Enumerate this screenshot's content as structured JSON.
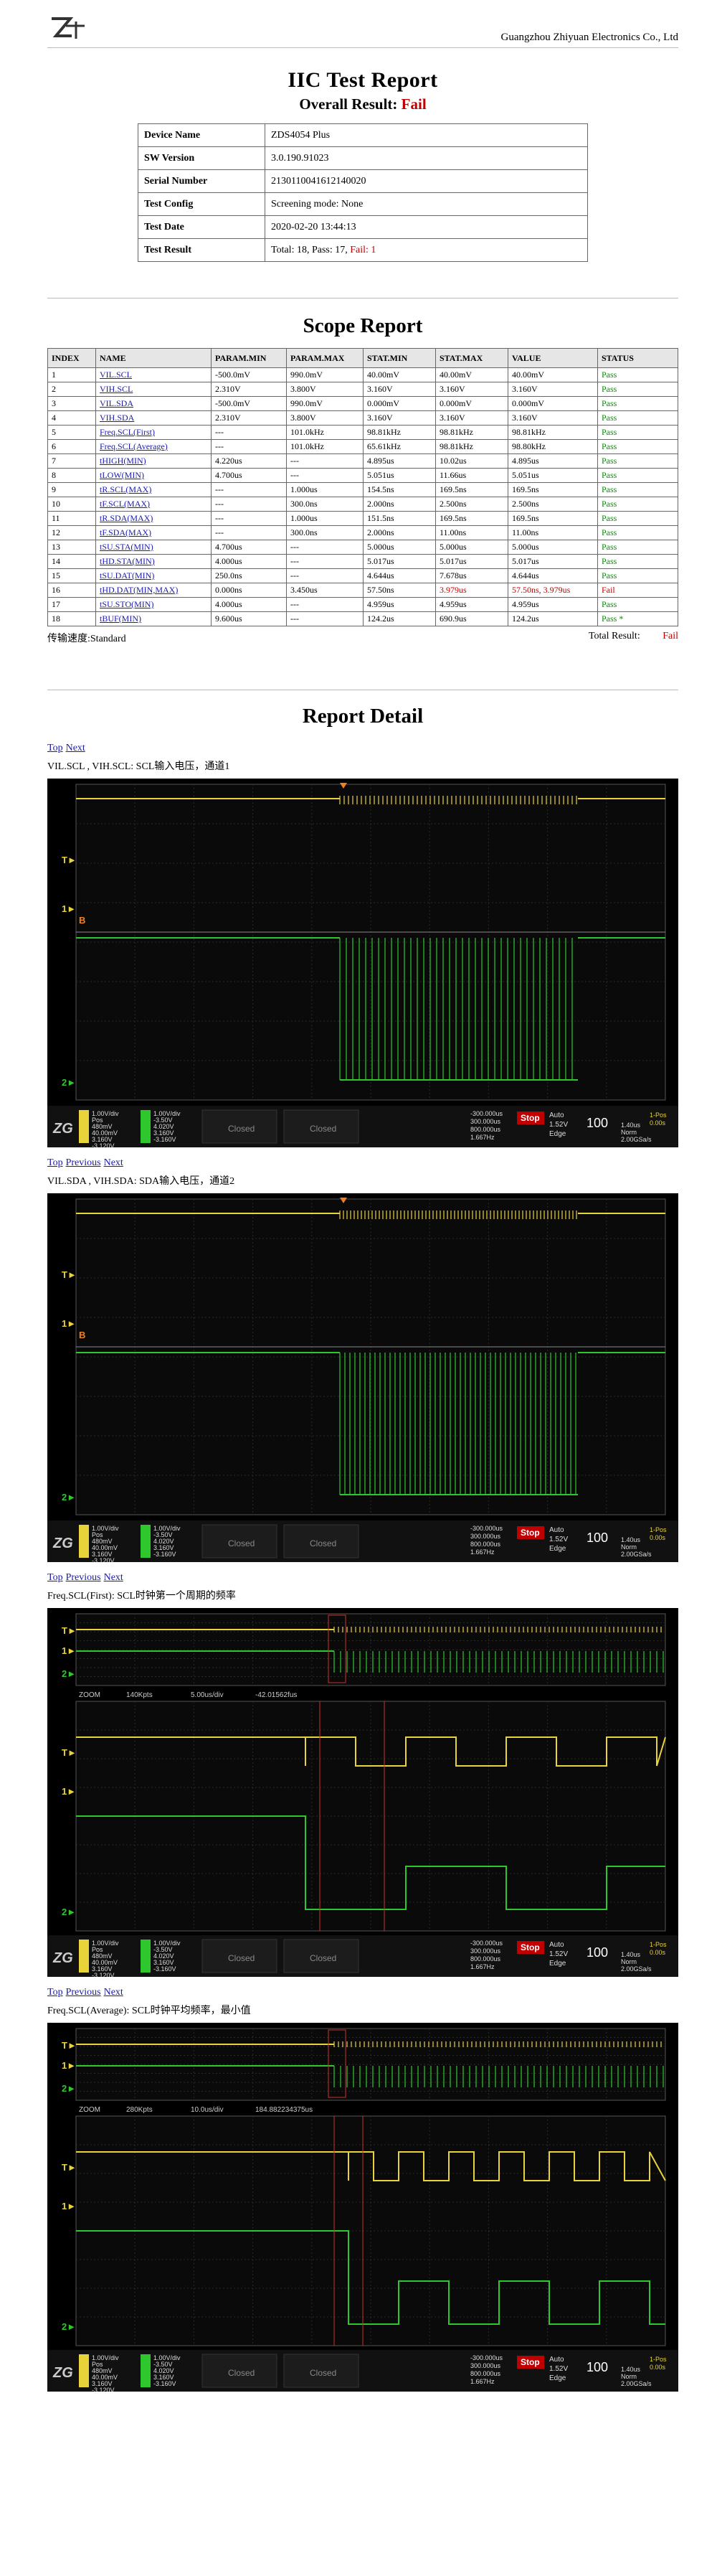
{
  "header": {
    "company": "Guangzhou Zhiyuan Electronics Co., Ltd"
  },
  "report": {
    "title": "IIC Test Report",
    "overall_label": "Overall Result: ",
    "overall_value": "Fail"
  },
  "info": {
    "device_name_k": "Device Name",
    "device_name_v": "ZDS4054 Plus",
    "sw_version_k": "SW Version",
    "sw_version_v": "3.0.190.91023",
    "serial_k": "Serial Number",
    "serial_v": "2130110041612140020",
    "config_k": "Test Config",
    "config_v": "Screening mode: None",
    "date_k": "Test Date",
    "date_v": "2020-02-20 13:44:13",
    "result_k": "Test Result",
    "result_prefix": "Total: 18, Pass: 17, ",
    "result_fail": "Fail: 1"
  },
  "scope": {
    "title": "Scope Report",
    "headers": [
      "INDEX",
      "NAME",
      "PARAM.MIN",
      "PARAM.MAX",
      "STAT.MIN",
      "STAT.MAX",
      "VALUE",
      "STATUS"
    ],
    "rows": [
      [
        "1",
        "VIL.SCL",
        "-500.0mV",
        "990.0mV",
        "40.00mV",
        "40.00mV",
        "40.00mV",
        "Pass"
      ],
      [
        "2",
        "VIH.SCL",
        "2.310V",
        "3.800V",
        "3.160V",
        "3.160V",
        "3.160V",
        "Pass"
      ],
      [
        "3",
        "VIL.SDA",
        "-500.0mV",
        "990.0mV",
        "0.000mV",
        "0.000mV",
        "0.000mV",
        "Pass"
      ],
      [
        "4",
        "VIH.SDA",
        "2.310V",
        "3.800V",
        "3.160V",
        "3.160V",
        "3.160V",
        "Pass"
      ],
      [
        "5",
        "Freq.SCL(First)",
        "---",
        "101.0kHz",
        "98.81kHz",
        "98.81kHz",
        "98.81kHz",
        "Pass"
      ],
      [
        "6",
        "Freq.SCL(Average)",
        "---",
        "101.0kHz",
        "65.61kHz",
        "98.81kHz",
        "98.80kHz",
        "Pass"
      ],
      [
        "7",
        "tHIGH(MIN)",
        "4.220us",
        "---",
        "4.895us",
        "10.02us",
        "4.895us",
        "Pass"
      ],
      [
        "8",
        "tLOW(MIN)",
        "4.700us",
        "---",
        "5.051us",
        "11.66us",
        "5.051us",
        "Pass"
      ],
      [
        "9",
        "tR.SCL(MAX)",
        "---",
        "1.000us",
        "154.5ns",
        "169.5ns",
        "169.5ns",
        "Pass"
      ],
      [
        "10",
        "tF.SCL(MAX)",
        "---",
        "300.0ns",
        "2.000ns",
        "2.500ns",
        "2.500ns",
        "Pass"
      ],
      [
        "11",
        "tR.SDA(MAX)",
        "---",
        "1.000us",
        "151.5ns",
        "169.5ns",
        "169.5ns",
        "Pass"
      ],
      [
        "12",
        "tF.SDA(MAX)",
        "---",
        "300.0ns",
        "2.000ns",
        "11.00ns",
        "11.00ns",
        "Pass"
      ],
      [
        "13",
        "tSU.STA(MIN)",
        "4.700us",
        "---",
        "5.000us",
        "5.000us",
        "5.000us",
        "Pass"
      ],
      [
        "14",
        "tHD.STA(MIN)",
        "4.000us",
        "---",
        "5.017us",
        "5.017us",
        "5.017us",
        "Pass"
      ],
      [
        "15",
        "tSU.DAT(MIN)",
        "250.0ns",
        "---",
        "4.644us",
        "7.678us",
        "4.644us",
        "Pass"
      ],
      [
        "16",
        "tHD.DAT(MIN,MAX)",
        "0.000ns",
        "3.450us",
        "57.50ns",
        "3.979us",
        "57.50ns, 3.979us",
        "Fail"
      ],
      [
        "17",
        "tSU.STO(MIN)",
        "4.000us",
        "---",
        "4.959us",
        "4.959us",
        "4.959us",
        "Pass"
      ],
      [
        "18",
        "tBUF(MIN)",
        "9.600us",
        "---",
        "124.2us",
        "690.9us",
        "124.2us",
        "Pass *"
      ]
    ],
    "speed_label": "传输速度:Standard",
    "total_label": "Total Result:",
    "total_value": "Fail"
  },
  "detail": {
    "title": "Report Detail",
    "nav_top": "Top",
    "nav_prev": "Previous",
    "nav_next": "Next",
    "sections": [
      {
        "caption": "VIL.SCL , VIH.SCL: SCL输入电压，通道1"
      },
      {
        "caption": "VIL.SDA , VIH.SDA: SDA输入电压，通道2"
      },
      {
        "caption": "Freq.SCL(First): SCL时钟第一个周期的频率"
      },
      {
        "caption": "Freq.SCL(Average): SCL时钟平均频率，最小值"
      }
    ]
  },
  "scope_ui": {
    "closed": "Closed",
    "stop": "Stop",
    "zoom_label": "ZOOM",
    "zoom_3": [
      "140Kpts",
      "5.00us/div",
      "-42.01562fus"
    ],
    "zoom_4": [
      "280Kpts",
      "10.0us/div",
      "184.882234375us"
    ],
    "ch1_panel": [
      "1.00V/div",
      "Pos",
      "480mV",
      "40.00mV",
      "3.160V",
      "-3.120V"
    ],
    "ch2_panel": [
      "1.00V/div",
      "-3.50V",
      "4.020V",
      "3.160V",
      "-3.160V"
    ],
    "timebase": [
      "-300.000us",
      "300.000us",
      "800.000us",
      "1.667Hz"
    ],
    "auto": [
      "Auto",
      "1.52V",
      "Edge"
    ],
    "rate": [
      "100",
      "1-Pos",
      "0.00s",
      "1.40us",
      "Norm",
      "2.00GSa/s"
    ]
  },
  "colors": {
    "ch1": "#e8d33a",
    "ch2": "#2ec82e",
    "fail": "#c00000",
    "pass": "#0a8a0a",
    "link": "#1a1ab0"
  }
}
